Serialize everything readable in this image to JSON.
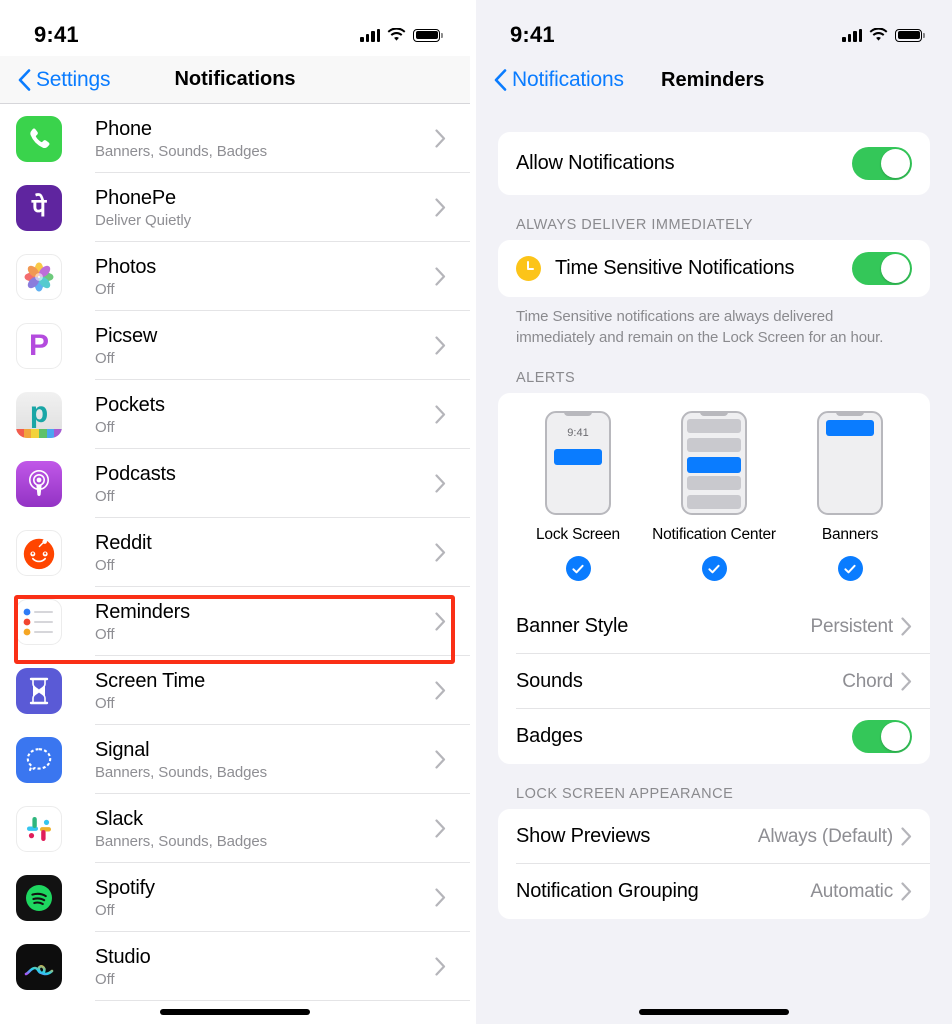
{
  "left": {
    "status": {
      "time": "9:41",
      "signal_icon": "cellular-bars-icon",
      "wifi_icon": "wifi-icon",
      "battery_icon": "battery-icon"
    },
    "nav": {
      "back_label": "Settings",
      "title": "Notifications",
      "back_icon": "chevron-left-icon"
    },
    "apps": [
      {
        "name": "Phone",
        "sub": "Banners, Sounds, Badges",
        "icon": "phone-app-icon"
      },
      {
        "name": "PhonePe",
        "sub": "Deliver Quietly",
        "icon": "phonepe-app-icon"
      },
      {
        "name": "Photos",
        "sub": "Off",
        "icon": "photos-app-icon"
      },
      {
        "name": "Picsew",
        "sub": "Off",
        "icon": "picsew-app-icon"
      },
      {
        "name": "Pockets",
        "sub": "Off",
        "icon": "pockets-app-icon"
      },
      {
        "name": "Podcasts",
        "sub": "Off",
        "icon": "podcasts-app-icon"
      },
      {
        "name": "Reddit",
        "sub": "Off",
        "icon": "reddit-app-icon"
      },
      {
        "name": "Reminders",
        "sub": "Off",
        "icon": "reminders-app-icon"
      },
      {
        "name": "Screen Time",
        "sub": "Off",
        "icon": "screen-time-app-icon"
      },
      {
        "name": "Signal",
        "sub": "Banners, Sounds, Badges",
        "icon": "signal-app-icon"
      },
      {
        "name": "Slack",
        "sub": "Banners, Sounds, Badges",
        "icon": "slack-app-icon"
      },
      {
        "name": "Spotify",
        "sub": "Off",
        "icon": "spotify-app-icon"
      },
      {
        "name": "Studio",
        "sub": "Off",
        "icon": "studio-app-icon"
      }
    ],
    "highlight": {
      "target": "Reminders",
      "color": "#fa2f16"
    }
  },
  "right": {
    "status": {
      "time": "9:41",
      "signal_icon": "cellular-bars-icon",
      "wifi_icon": "wifi-icon",
      "battery_icon": "battery-icon"
    },
    "nav": {
      "back_label": "Notifications",
      "title": "Reminders",
      "back_icon": "chevron-left-icon"
    },
    "allow": {
      "label": "Allow Notifications",
      "state": "on"
    },
    "immediate": {
      "section": "ALWAYS DELIVER IMMEDIATELY",
      "label": "Time Sensitive Notifications",
      "icon": "clock-icon",
      "state": "on",
      "footnote": "Time Sensitive notifications are always delivered immediately and remain on the Lock Screen for an hour."
    },
    "alerts": {
      "section": "ALERTS",
      "options": [
        {
          "label": "Lock Screen",
          "selected": true,
          "preview_time": "9:41"
        },
        {
          "label": "Notification Center",
          "selected": true
        },
        {
          "label": "Banners",
          "selected": true
        }
      ],
      "rows": [
        {
          "label": "Banner Style",
          "value": "Persistent",
          "type": "disclosure"
        },
        {
          "label": "Sounds",
          "value": "Chord",
          "type": "disclosure"
        },
        {
          "label": "Badges",
          "value": "",
          "type": "toggle",
          "state": "on"
        }
      ]
    },
    "lockscreen": {
      "section": "LOCK SCREEN APPEARANCE",
      "rows": [
        {
          "label": "Show Previews",
          "value": "Always (Default)"
        },
        {
          "label": "Notification Grouping",
          "value": "Automatic"
        }
      ]
    }
  },
  "colors": {
    "accent_blue": "#0a7cff",
    "toggle_green": "#34c759",
    "highlight_red": "#fa2f16",
    "group_bg": "#f2f2f7"
  }
}
